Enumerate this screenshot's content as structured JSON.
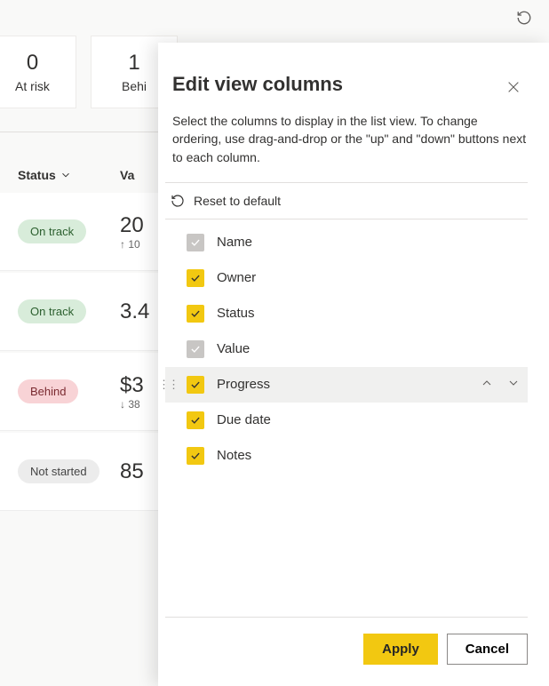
{
  "topbar": {
    "refresh_icon": "refresh"
  },
  "cards": [
    {
      "num": "0",
      "label": "At risk"
    },
    {
      "num": "1",
      "label": "Behi"
    }
  ],
  "grid": {
    "headers": {
      "status": "Status",
      "value": "Va"
    },
    "rows": [
      {
        "status_label": "On track",
        "status_kind": "ontrack",
        "value": "20",
        "sub": "↑ 10"
      },
      {
        "status_label": "On track",
        "status_kind": "ontrack",
        "value": "3.4",
        "sub": ""
      },
      {
        "status_label": "Behind",
        "status_kind": "behind",
        "value": "$3",
        "sub": "↓ 38"
      },
      {
        "status_label": "Not started",
        "status_kind": "notstarted",
        "value": "85",
        "sub": ""
      }
    ]
  },
  "panel": {
    "title": "Edit view columns",
    "description": "Select the columns to display in the list view. To change ordering, use drag-and-drop or the \"up\" and \"down\" buttons next to each column.",
    "reset_label": "Reset to default",
    "columns": [
      {
        "label": "Name",
        "checked": true,
        "disabled": true,
        "hovered": false
      },
      {
        "label": "Owner",
        "checked": true,
        "disabled": false,
        "hovered": false
      },
      {
        "label": "Status",
        "checked": true,
        "disabled": false,
        "hovered": false
      },
      {
        "label": "Value",
        "checked": true,
        "disabled": true,
        "hovered": false
      },
      {
        "label": "Progress",
        "checked": true,
        "disabled": false,
        "hovered": true
      },
      {
        "label": "Due date",
        "checked": true,
        "disabled": false,
        "hovered": false
      },
      {
        "label": "Notes",
        "checked": true,
        "disabled": false,
        "hovered": false
      }
    ],
    "apply_label": "Apply",
    "cancel_label": "Cancel"
  }
}
